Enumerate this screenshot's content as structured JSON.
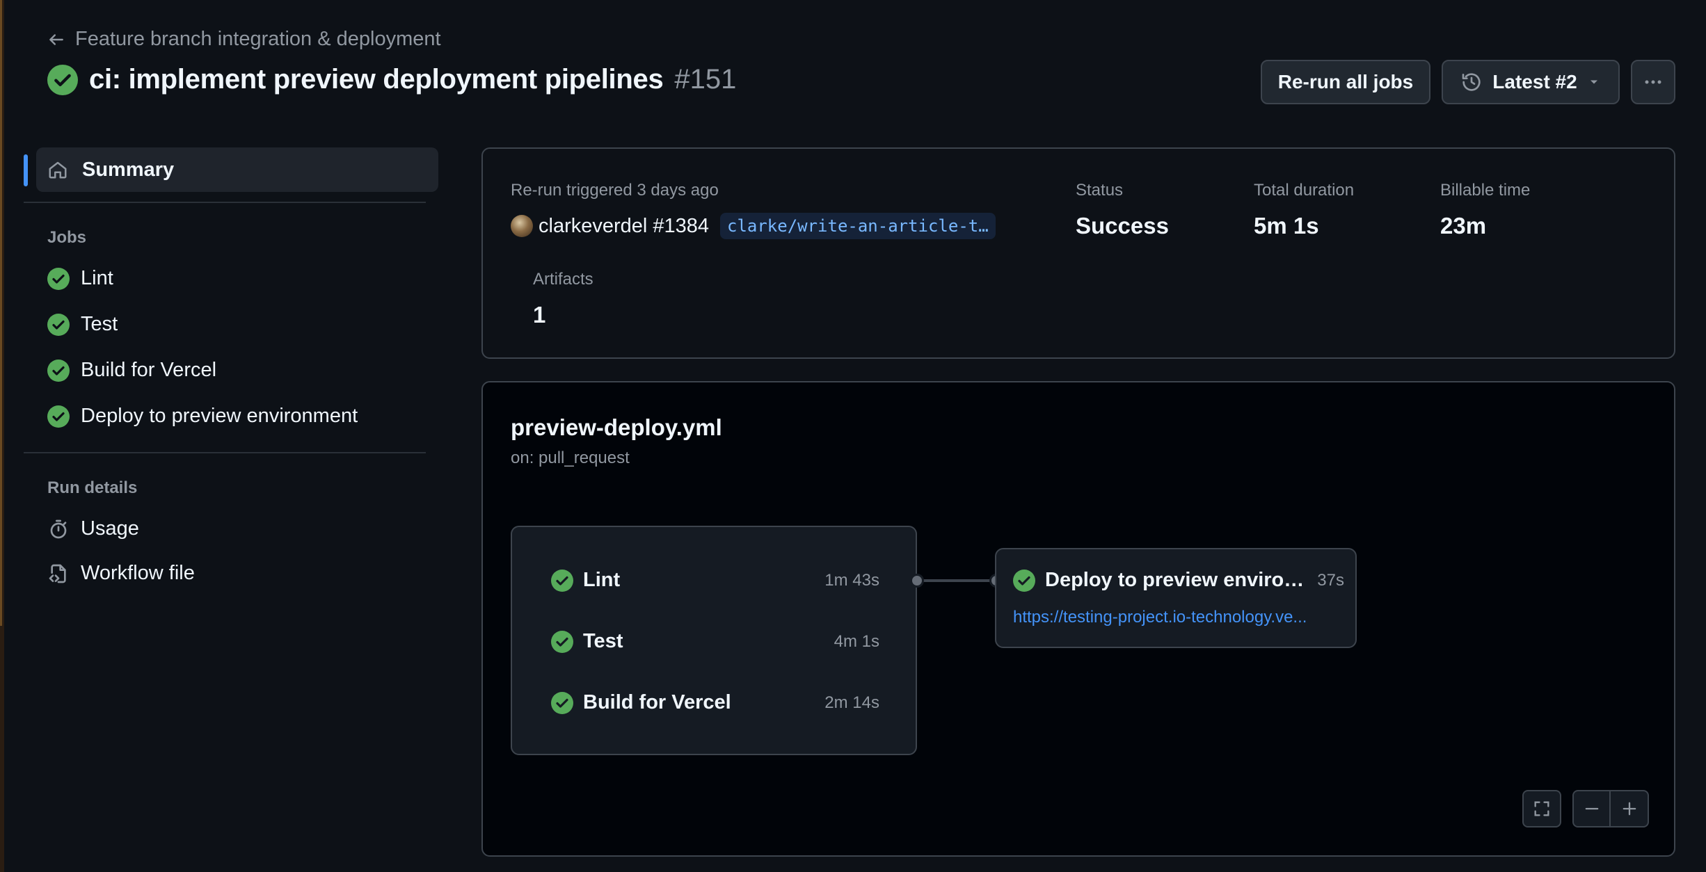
{
  "header": {
    "back_label": "Feature branch integration & deployment",
    "title": "ci: implement preview deployment pipelines",
    "run_number": "#151",
    "rerun_button": "Re-run all jobs",
    "attempt_button": "Latest #2"
  },
  "sidebar": {
    "summary_label": "Summary",
    "jobs_heading": "Jobs",
    "jobs": [
      {
        "label": "Lint",
        "status": "success"
      },
      {
        "label": "Test",
        "status": "success"
      },
      {
        "label": "Build for Vercel",
        "status": "success"
      },
      {
        "label": "Deploy to preview environment",
        "status": "success"
      }
    ],
    "run_details_heading": "Run details",
    "usage_label": "Usage",
    "workflow_file_label": "Workflow file"
  },
  "summary": {
    "trigger_label": "Re-run triggered 3 days ago",
    "actor": "clarkeverdel",
    "pr_number": "#1384",
    "branch": "clarke/write-an-article-t…",
    "status_label": "Status",
    "status_value": "Success",
    "duration_label": "Total duration",
    "duration_value": "5m 1s",
    "billable_label": "Billable time",
    "billable_value": "23m",
    "artifacts_label": "Artifacts",
    "artifacts_value": "1"
  },
  "workflow": {
    "file_name": "preview-deploy.yml",
    "trigger": "on: pull_request",
    "group_jobs": [
      {
        "name": "Lint",
        "duration": "1m 43s"
      },
      {
        "name": "Test",
        "duration": "4m 1s"
      },
      {
        "name": "Build for Vercel",
        "duration": "2m 14s"
      }
    ],
    "deploy_job": {
      "name": "Deploy to preview environ...",
      "duration": "37s",
      "url": "https://testing-project.io-technology.ve..."
    }
  },
  "colors": {
    "success": "#57ab5a",
    "accent": "#4493f8",
    "link": "#4493f8"
  }
}
